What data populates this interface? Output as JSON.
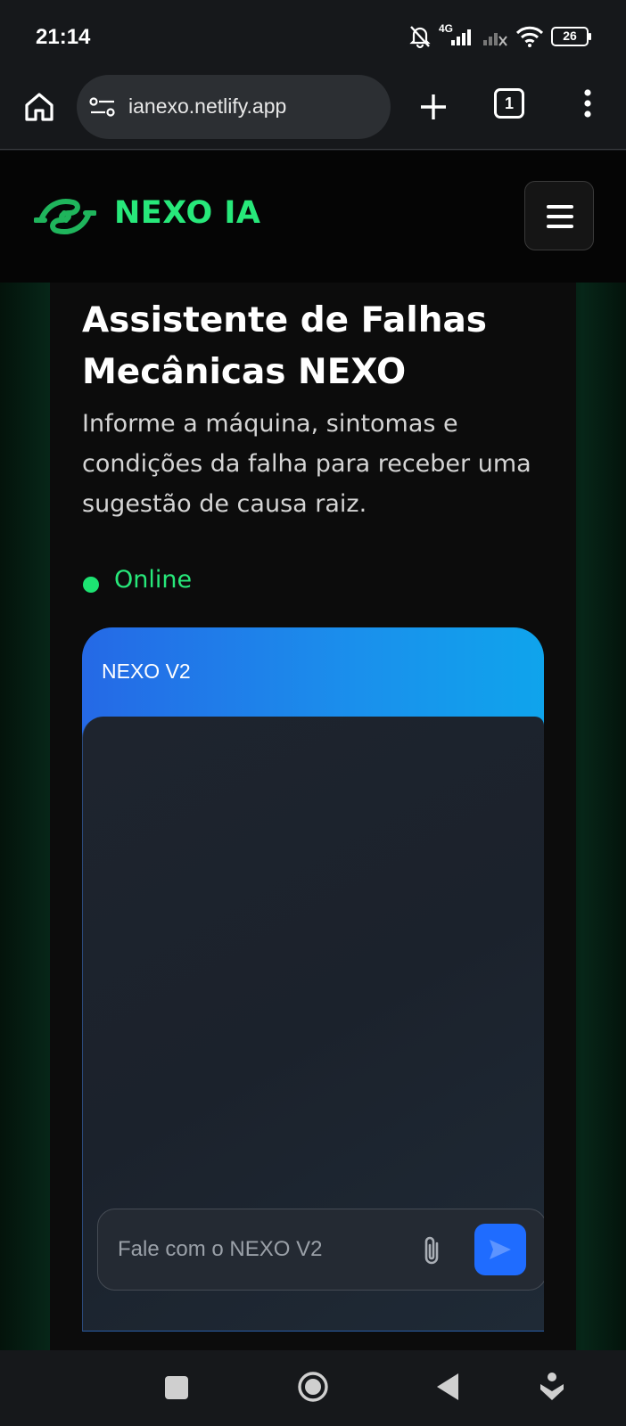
{
  "status_bar": {
    "time": "21:14",
    "network_label": "4G",
    "battery_level": "26",
    "icons": [
      "bell-off-icon",
      "signal-icon",
      "signal-off-icon",
      "wifi-icon",
      "battery-icon"
    ]
  },
  "browser": {
    "url": "ianexo.netlify.app",
    "tab_count": "1",
    "icons": [
      "home-icon",
      "site-settings-icon",
      "plus-icon",
      "tabs-icon",
      "kebab-menu-icon"
    ]
  },
  "site": {
    "brand": "NEXO IA",
    "colors": {
      "brand_green": "#27e87a",
      "online_green": "#1de372",
      "send_blue": "#1f6cff"
    }
  },
  "hero": {
    "title": "Assistente de Falhas Mecânicas NEXO",
    "subtitle": "Informe a máquina, sintomas e condições da falha para receber uma sugestão de causa raiz.",
    "status": "Online"
  },
  "chat": {
    "title": "NEXO V2",
    "input_placeholder": "Fale com o NEXO V2",
    "input_value": ""
  },
  "nav_bar": {
    "icons": [
      "recents-icon",
      "home-circle-icon",
      "back-icon",
      "assistant-icon"
    ]
  }
}
